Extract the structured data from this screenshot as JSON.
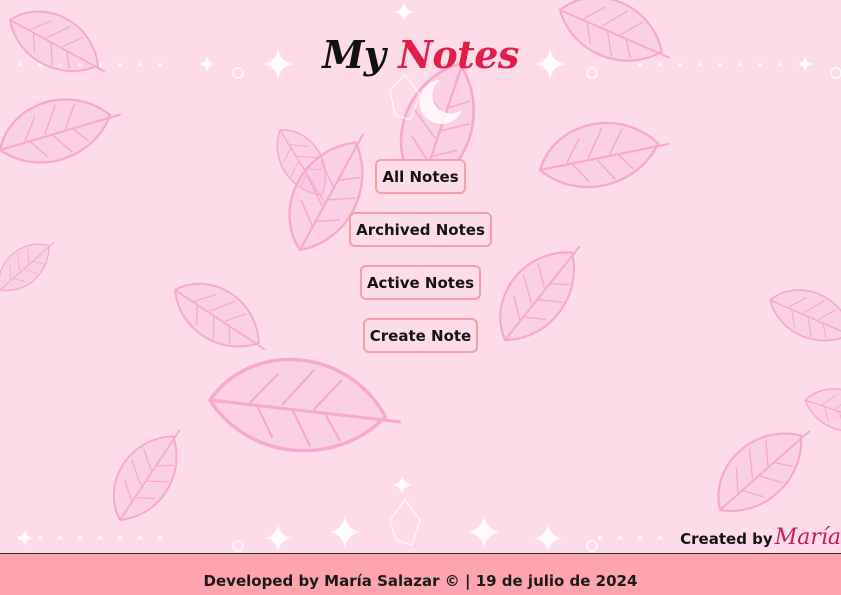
{
  "header": {
    "title_part1": "My",
    "title_part2": "Notes"
  },
  "nav": {
    "all_notes": "All Notes",
    "archived_notes": "Archived Notes",
    "active_notes": "Active Notes",
    "create_note": "Create Note"
  },
  "credit": {
    "label": "Created by",
    "name": "María"
  },
  "footer": {
    "text": "Developed by María Salazar © | 19 de julio de 2024"
  },
  "colors": {
    "background": "#fddbe9",
    "title_accent": "#e11d48",
    "button_border": "#f3a0a8",
    "footer_bg": "#fda4ae",
    "leaf_outline": "#f7a8cf"
  },
  "icons": [
    "leaf-icon",
    "sparkle-icon",
    "moon-icon",
    "crystal-icon"
  ]
}
